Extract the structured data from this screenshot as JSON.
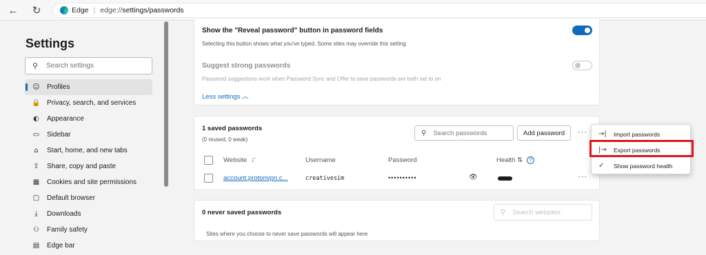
{
  "browser": {
    "back_icon": "←",
    "refresh_icon": "↻",
    "brand": "Edge",
    "url_prefix": "edge://",
    "url_path": "settings/passwords"
  },
  "sidebar": {
    "title": "Settings",
    "search_placeholder": "Search settings",
    "items": [
      {
        "label": "Profiles",
        "icon": "☺"
      },
      {
        "label": "Privacy, search, and services",
        "icon": "🔒"
      },
      {
        "label": "Appearance",
        "icon": "◐"
      },
      {
        "label": "Sidebar",
        "icon": "▭"
      },
      {
        "label": "Start, home, and new tabs",
        "icon": "⌂"
      },
      {
        "label": "Share, copy and paste",
        "icon": "⇪"
      },
      {
        "label": "Cookies and site permissions",
        "icon": "▦"
      },
      {
        "label": "Default browser",
        "icon": "▢"
      },
      {
        "label": "Downloads",
        "icon": "⤓"
      },
      {
        "label": "Family safety",
        "icon": "⚇"
      },
      {
        "label": "Edge bar",
        "icon": "▤"
      }
    ]
  },
  "settings": {
    "reveal_title": "Show the \"Reveal password\" button in password fields",
    "reveal_desc": "Selecting this button shows what you've typed. Some sites may override this setting",
    "reveal_on": true,
    "suggest_title": "Suggest strong passwords",
    "suggest_desc": "Password suggestions work when Password Sync and Offer to save passwords are both set to on",
    "suggest_on": false,
    "less_label": "Less settings",
    "less_icon": "︿"
  },
  "saved": {
    "count_label": "1 saved passwords",
    "sub_label": "(0 reused, 0 weak)",
    "search_placeholder": "Search passwords",
    "add_label": "Add password",
    "more_icon": "···",
    "columns": {
      "website": "Website",
      "username": "Username",
      "password": "Password",
      "health": "Health",
      "sort_icon": "↓̄",
      "health_sort_icon": "⇅",
      "help_icon": "?"
    },
    "rows": [
      {
        "website": "account.protonvpn.c...",
        "username": "creativesim",
        "password": "••••••••••",
        "eye_icon": "👁",
        "more_icon": "···"
      }
    ]
  },
  "never": {
    "title": "0 never saved passwords",
    "search_placeholder": "Search websites",
    "desc": "Sites where you choose to never save passwords will appear here"
  },
  "menu": {
    "items": [
      {
        "label": "Import passwords",
        "icon": "→|"
      },
      {
        "label": "Export passwords",
        "icon": "|→"
      },
      {
        "label": "Show password health",
        "icon": "✓"
      }
    ],
    "highlight_color": "#e0141e"
  },
  "colors": {
    "accent": "#0f6cbd",
    "highlight": "#e0141e"
  }
}
